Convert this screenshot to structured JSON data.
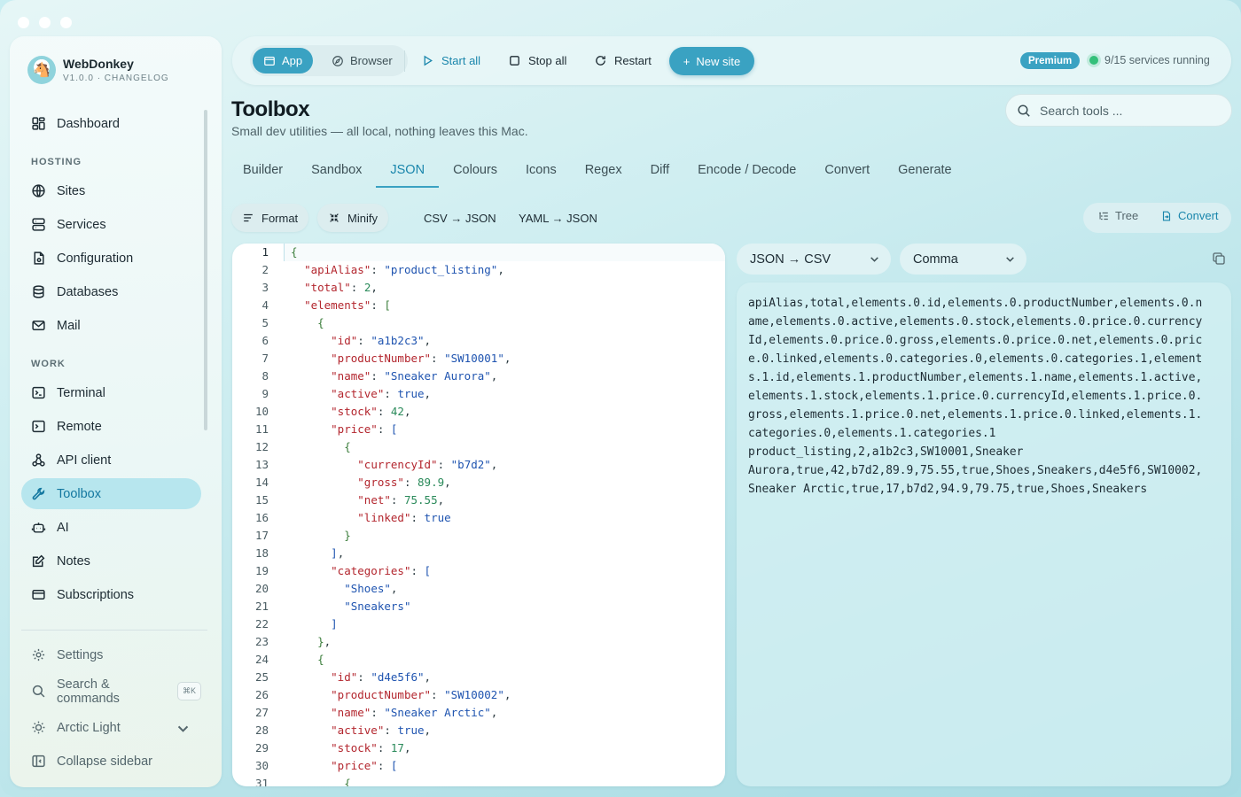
{
  "app": {
    "name": "WebDonkey",
    "version": "V1.0.0 · CHANGELOG"
  },
  "sidebar": {
    "items_top": [
      {
        "label": "Dashboard",
        "icon": "grid-icon"
      }
    ],
    "section_hosting": "HOSTING",
    "hosting": [
      {
        "label": "Sites",
        "icon": "globe-icon"
      },
      {
        "label": "Services",
        "icon": "server-icon"
      },
      {
        "label": "Configuration",
        "icon": "config-file-icon"
      },
      {
        "label": "Databases",
        "icon": "database-icon"
      },
      {
        "label": "Mail",
        "icon": "mail-icon"
      }
    ],
    "section_work": "WORK",
    "work": [
      {
        "label": "Terminal",
        "icon": "terminal-icon"
      },
      {
        "label": "Remote",
        "icon": "remote-icon"
      },
      {
        "label": "API client",
        "icon": "api-icon"
      },
      {
        "label": "Toolbox",
        "icon": "wrench-icon",
        "active": true
      },
      {
        "label": "AI",
        "icon": "robot-icon"
      },
      {
        "label": "Notes",
        "icon": "notes-icon"
      },
      {
        "label": "Subscriptions",
        "icon": "card-icon"
      }
    ],
    "footer": {
      "settings": "Settings",
      "search": "Search & commands",
      "search_kbd": "⌘K",
      "theme": "Arctic Light",
      "collapse": "Collapse sidebar"
    }
  },
  "toolbar": {
    "mode_app": "App",
    "mode_browser": "Browser",
    "start_all": "Start all",
    "stop_all": "Stop all",
    "restart": "Restart",
    "new_site": "New site",
    "premium": "Premium",
    "services_status": "9/15 services running"
  },
  "header": {
    "title": "Toolbox",
    "subtitle": "Small dev utilities — all local, nothing leaves this Mac.",
    "search_placeholder": "Search tools ..."
  },
  "tabs": [
    "Builder",
    "Sandbox",
    "JSON",
    "Colours",
    "Icons",
    "Regex",
    "Diff",
    "Encode / Decode",
    "Convert",
    "Generate"
  ],
  "active_tab": "JSON",
  "tools": {
    "format": "Format",
    "minify": "Minify",
    "csv_json": "CSV → JSON",
    "yaml_json": "YAML → JSON",
    "tree": "Tree",
    "convert": "Convert"
  },
  "editor": {
    "line_numbers": [
      "1",
      "2",
      "3",
      "4",
      "5",
      "6",
      "7",
      "8",
      "9",
      "10",
      "11",
      "12",
      "13",
      "14",
      "15",
      "16",
      "17",
      "18",
      "19",
      "20",
      "21",
      "22",
      "23",
      "24",
      "25",
      "26",
      "27",
      "28",
      "29",
      "30",
      "31"
    ],
    "current_line": 1
  },
  "output": {
    "format_select": "JSON → CSV",
    "delimiter_select": "Comma",
    "lines": [
      "apiAlias,total,elements.0.id,elements.0.productNumber,elements.0.n",
      "ame,elements.0.active,elements.0.stock,elements.0.price.0.currency",
      "Id,elements.0.price.0.gross,elements.0.price.0.net,elements.0.pric",
      "e.0.linked,elements.0.categories.0,elements.0.categories.1,element",
      "s.1.id,elements.1.productNumber,elements.1.name,elements.1.active,",
      "elements.1.stock,elements.1.price.0.currencyId,elements.1.price.0.",
      "gross,elements.1.price.0.net,elements.1.price.0.linked,elements.1.",
      "categories.0,elements.1.categories.1",
      "product_listing,2,a1b2c3,SW10001,Sneaker",
      "Aurora,true,42,b7d2,89.9,75.55,true,Shoes,Sneakers,d4e5f6,SW10002,",
      "Sneaker Arctic,true,17,b7d2,94.9,79.75,true,Shoes,Sneakers"
    ]
  },
  "colors": {
    "accent": "#3aa2c2",
    "active_nav_bg": "#b7e6ee",
    "json_key": "#b3262e",
    "json_string": "#1f54b0",
    "json_number": "#2a8a5a",
    "status_dot": "#34c07a"
  }
}
